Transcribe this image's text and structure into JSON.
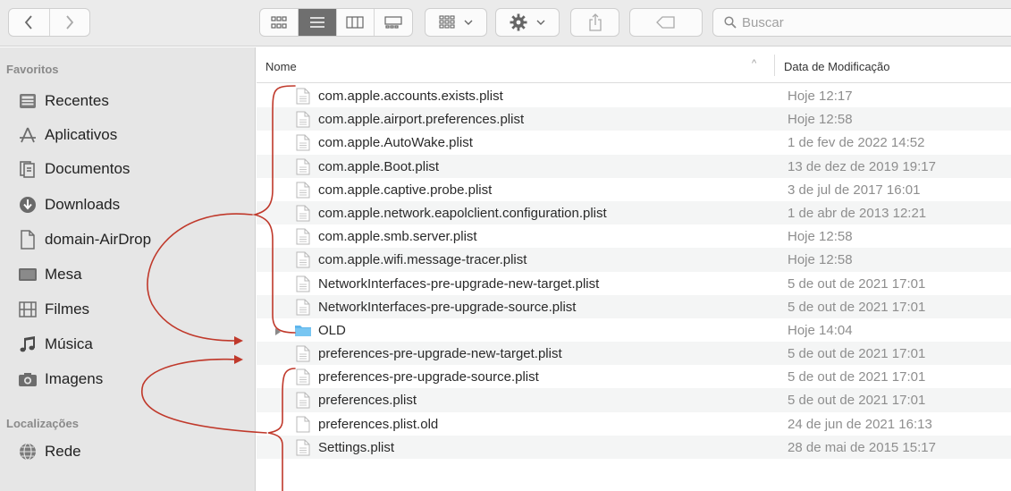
{
  "toolbar": {
    "search": {
      "placeholder": "Buscar"
    }
  },
  "sidebar": {
    "favorites_title": "Favoritos",
    "favorites": [
      {
        "label": "Recentes",
        "icon": "clock-icon"
      },
      {
        "label": "Aplicativos",
        "icon": "apps-icon"
      },
      {
        "label": "Documentos",
        "icon": "document-icon"
      },
      {
        "label": "Downloads",
        "icon": "download-icon"
      },
      {
        "label": "domain-AirDrop",
        "icon": "file-icon"
      },
      {
        "label": "Mesa",
        "icon": "desktop-icon"
      },
      {
        "label": "Filmes",
        "icon": "film-icon"
      },
      {
        "label": "Música",
        "icon": "music-icon"
      },
      {
        "label": "Imagens",
        "icon": "camera-icon"
      }
    ],
    "locations_title": "Localizações",
    "locations": [
      {
        "label": "Rede",
        "icon": "globe-icon"
      }
    ]
  },
  "list": {
    "col_name": "Nome",
    "col_date": "Data de Modificação",
    "rows": [
      {
        "name": "com.apple.accounts.exists.plist",
        "date": "Hoje 12:17",
        "kind": "file"
      },
      {
        "name": "com.apple.airport.preferences.plist",
        "date": "Hoje 12:58",
        "kind": "file"
      },
      {
        "name": "com.apple.AutoWake.plist",
        "date": "1 de fev de 2022 14:52",
        "kind": "file"
      },
      {
        "name": "com.apple.Boot.plist",
        "date": "13 de dez de 2019 19:17",
        "kind": "file"
      },
      {
        "name": "com.apple.captive.probe.plist",
        "date": "3 de jul de 2017 16:01",
        "kind": "file"
      },
      {
        "name": "com.apple.network.eapolclient.configuration.plist",
        "date": "1 de abr de 2013 12:21",
        "kind": "file"
      },
      {
        "name": "com.apple.smb.server.plist",
        "date": "Hoje 12:58",
        "kind": "file"
      },
      {
        "name": "com.apple.wifi.message-tracer.plist",
        "date": "Hoje 12:58",
        "kind": "file"
      },
      {
        "name": "NetworkInterfaces-pre-upgrade-new-target.plist",
        "date": "5 de out de 2021 17:01",
        "kind": "file"
      },
      {
        "name": "NetworkInterfaces-pre-upgrade-source.plist",
        "date": "5 de out de 2021 17:01",
        "kind": "file"
      },
      {
        "name": "OLD",
        "date": "Hoje 14:04",
        "kind": "folder"
      },
      {
        "name": "preferences-pre-upgrade-new-target.plist",
        "date": "5 de out de 2021 17:01",
        "kind": "file"
      },
      {
        "name": "preferences-pre-upgrade-source.plist",
        "date": "5 de out de 2021 17:01",
        "kind": "file"
      },
      {
        "name": "preferences.plist",
        "date": "5 de out de 2021 17:01",
        "kind": "file"
      },
      {
        "name": "preferences.plist.old",
        "date": "24 de jun de 2021 16:13",
        "kind": "blank"
      },
      {
        "name": "Settings.plist",
        "date": "28 de mai de 2015 15:17",
        "kind": "file"
      }
    ]
  }
}
